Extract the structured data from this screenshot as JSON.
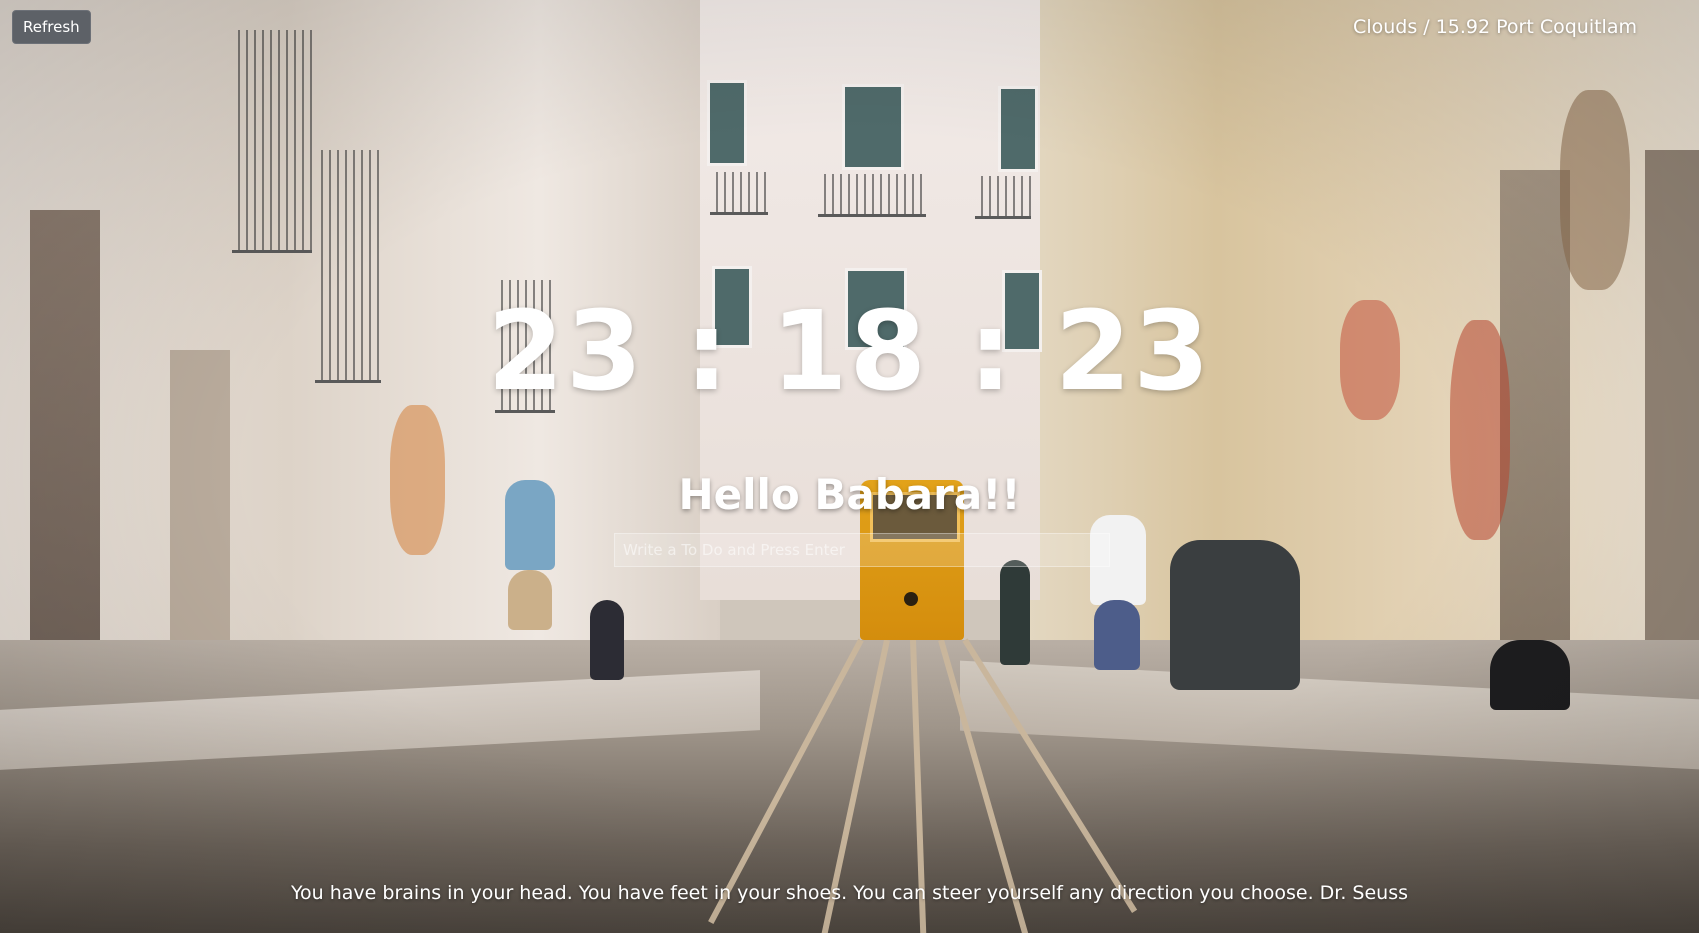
{
  "toolbar": {
    "refresh_label": "Refresh"
  },
  "weather": {
    "text": "Clouds / 15.92 Port Coquitlam"
  },
  "clock": {
    "time": "23 : 18 : 23"
  },
  "greeting": {
    "text": "Hello Babara!!"
  },
  "todo": {
    "placeholder": "Write a To Do and Press Enter",
    "value": ""
  },
  "quote": {
    "text": "You have brains in your head. You have feet in your shoes. You can steer yourself any direction you choose. Dr. Seuss"
  },
  "background": {
    "description_icon": "street-tram-photo",
    "colors": {
      "tram": "#d9960f",
      "text": "#ffffff",
      "button_bg": "#5d6167"
    }
  }
}
